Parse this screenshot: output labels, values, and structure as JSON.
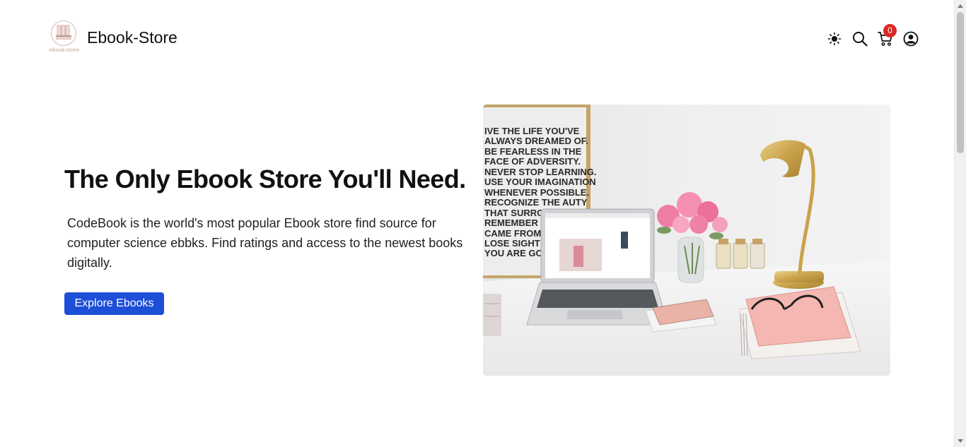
{
  "header": {
    "brand_name": "Ebook-Store",
    "logo_caption": "ebook-store",
    "cart_count": "0",
    "icons": [
      "sun-icon",
      "search-icon",
      "cart-icon",
      "user-icon"
    ]
  },
  "hero": {
    "title": "The Only Ebook Store You'll Need.",
    "description": "CodeBook is the world's most popular Ebook store find source for computer science ebbks. Find ratings and access to the newest books digitally.",
    "button_label": "Explore Ebooks",
    "poster_lines": [
      "IVE THE LIFE YOU'VE",
      "ALWAYS DREAMED OF.",
      "BE FEARLESS IN THE",
      "FACE OF ADVERSITY.",
      "NEVER STOP LEARNING.",
      "USE YOUR IMAGINATION",
      "WHENEVER POSSIBLE.",
      "RECOGNIZE THE    AUTY",
      "THAT SURROUN",
      "REMEMBER WH",
      "CAME FROM, BU",
      "LOSE SIGHT OF",
      "YOU ARE GO"
    ]
  },
  "colors": {
    "accent": "#1d4ed8",
    "badge": "#dc2626",
    "text": "#111111"
  }
}
